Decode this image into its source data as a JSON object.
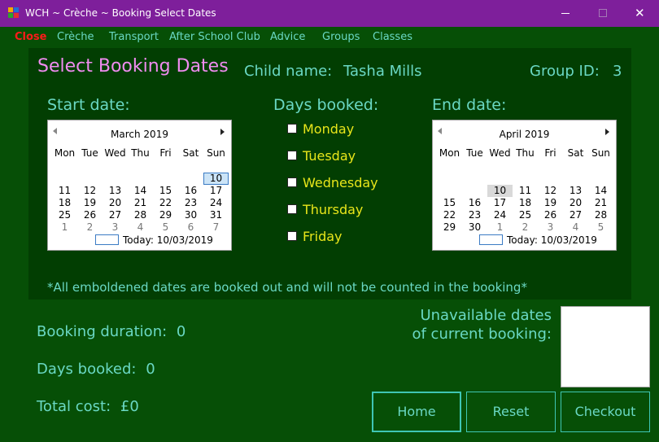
{
  "window": {
    "title": "WCH ~ Crèche ~ Booking Select Dates",
    "controls": {
      "minimize": "—",
      "maximize": "□",
      "close": "✕"
    }
  },
  "menu": [
    "Close",
    "Crèche",
    "Transport",
    "After School Club",
    "Advice",
    "Groups",
    "Classes"
  ],
  "page": {
    "title": "Select Booking Dates",
    "child_label": "Child name:",
    "child_value": "Tasha Mills",
    "group_label": "Group ID:",
    "group_value": "3"
  },
  "start": {
    "label": "Start date:",
    "calendar": {
      "month": "March 2019",
      "dow": [
        "Mon",
        "Tue",
        "Wed",
        "Thu",
        "Fri",
        "Sat",
        "Sun"
      ],
      "weeks": [
        [
          "",
          "",
          "",
          "",
          "",
          "",
          "10"
        ],
        [
          "11",
          "12",
          "13",
          "14",
          "15",
          "16",
          "17"
        ],
        [
          "18",
          "19",
          "20",
          "21",
          "22",
          "23",
          "24"
        ],
        [
          "25",
          "26",
          "27",
          "28",
          "29",
          "30",
          "31"
        ],
        [
          "1",
          "2",
          "3",
          "4",
          "5",
          "6",
          "7"
        ]
      ],
      "today": "Today: 10/03/2019"
    }
  },
  "days": {
    "label": "Days booked:",
    "items": [
      "Monday",
      "Tuesday",
      "Wednesday",
      "Thursday",
      "Friday"
    ]
  },
  "end": {
    "label": "End date:",
    "calendar": {
      "month": "April 2019",
      "dow": [
        "Mon",
        "Tue",
        "Wed",
        "Thu",
        "Fri",
        "Sat",
        "Sun"
      ],
      "weeks": [
        [
          "",
          "",
          "10",
          "11",
          "12",
          "13",
          "14"
        ],
        [
          "15",
          "16",
          "17",
          "18",
          "19",
          "20",
          "21"
        ],
        [
          "22",
          "23",
          "24",
          "25",
          "26",
          "27",
          "28"
        ],
        [
          "29",
          "30",
          "1",
          "2",
          "3",
          "4",
          "5"
        ]
      ],
      "today": "Today: 10/03/2019"
    }
  },
  "footnote": "*All emboldened dates are booked out and will not be counted in the booking*",
  "summary": {
    "duration_label": "Booking duration:",
    "duration_value": "0",
    "days_label": "Days booked:",
    "days_value": "0",
    "cost_label": "Total cost:",
    "cost_value": "£0"
  },
  "unavailable": {
    "line1": "Unavailable dates",
    "line2": "of current booking:"
  },
  "buttons": {
    "home": "Home",
    "reset": "Reset",
    "checkout": "Checkout"
  },
  "colors": {
    "titlebar": "#7e1f9b",
    "background": "#064f06",
    "panel": "#023e02",
    "accent_teal": "#6ad8c4",
    "title_pink": "#f08cf0",
    "day_yellow": "#e9e61a",
    "menu_close_red": "#ff1a1a"
  }
}
